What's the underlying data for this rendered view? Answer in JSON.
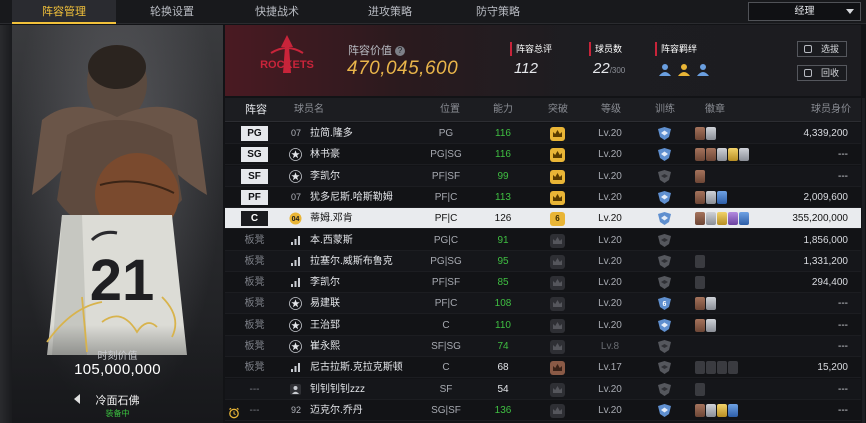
{
  "tabs": [
    {
      "label": "阵容管理",
      "active": true
    },
    {
      "label": "轮换设置",
      "active": false
    },
    {
      "label": "快捷战术",
      "active": false
    },
    {
      "label": "进攻策略",
      "active": false
    },
    {
      "label": "防守策略",
      "active": false
    }
  ],
  "role_select": {
    "value": "经理"
  },
  "card": {
    "jersey_number": "21",
    "value_label": "时刻价值",
    "value": "105,000,000",
    "name": "冷面石佛",
    "status": "装备中"
  },
  "header": {
    "team_logo_text": "ROCKETS",
    "lineup_value_label": "阵容价值",
    "lineup_value": "470,045,600",
    "rating_label": "阵容总评",
    "rating": "112",
    "count_label": "球员数",
    "count": "22",
    "count_max": "/300",
    "bond_label": "阵容羁绊",
    "btn_select": "选拔",
    "btn_recycle": "回收"
  },
  "table": {
    "headers": {
      "lineup": "阵容",
      "name": "球员名",
      "position": "位置",
      "ability": "能力",
      "breakthrough": "突破",
      "level": "等级",
      "training": "训练",
      "badges": "徽章",
      "value": "球员身价"
    },
    "rows": [
      {
        "slot": "PG",
        "starter": true,
        "num": "07",
        "icon": "",
        "name": "拉简.隆多",
        "pos": "PG",
        "ability": "116",
        "ability_color": "green",
        "bt": "on",
        "bt_num": "",
        "level": "Lv.20",
        "shield": "blue",
        "badges": [
          "copper",
          "silver"
        ],
        "value": "4,339,200"
      },
      {
        "slot": "SG",
        "starter": true,
        "num": "",
        "icon": "star",
        "name": "林书豪",
        "pos": "PG|SG",
        "ability": "116",
        "ability_color": "green",
        "bt": "on",
        "bt_num": "",
        "level": "Lv.20",
        "shield": "blue",
        "badges": [
          "copper",
          "copper",
          "silver",
          "gold",
          "silver"
        ],
        "value": "---"
      },
      {
        "slot": "SF",
        "starter": true,
        "num": "",
        "icon": "star",
        "name": "李凯尔",
        "pos": "PF|SF",
        "ability": "99",
        "ability_color": "green",
        "bt": "on",
        "bt_num": "",
        "level": "Lv.20",
        "shield": "grey",
        "badges": [
          "copper"
        ],
        "value": "---"
      },
      {
        "slot": "PF",
        "starter": true,
        "num": "07",
        "icon": "",
        "name": "犹多尼斯.哈斯勒姆",
        "pos": "PF|C",
        "ability": "113",
        "ability_color": "green",
        "bt": "on",
        "bt_num": "",
        "level": "Lv.20",
        "shield": "blue",
        "badges": [
          "copper",
          "silver",
          "blue"
        ],
        "value": "2,009,600"
      },
      {
        "slot": "C",
        "starter": true,
        "num": "",
        "icon": "gold04",
        "name": "蒂姆.邓肯",
        "pos": "PF|C",
        "ability": "126",
        "ability_color": "white",
        "bt": "on",
        "bt_num": "6",
        "level": "Lv.20",
        "shield": "blue",
        "badges": [
          "copper",
          "silver",
          "gold",
          "purple",
          "blue"
        ],
        "value": "355,200,000",
        "selected": true
      },
      {
        "slot": "板凳",
        "starter": false,
        "num": "",
        "icon": "bars",
        "name": "本.西蒙斯",
        "pos": "PG|C",
        "ability": "91",
        "ability_color": "green",
        "bt": "off",
        "bt_num": "",
        "level": "Lv.20",
        "shield": "grey",
        "badges": [],
        "value": "1,856,000"
      },
      {
        "slot": "板凳",
        "starter": false,
        "num": "",
        "icon": "bars",
        "name": "拉塞尔.威斯布鲁克",
        "pos": "PG|SG",
        "ability": "95",
        "ability_color": "green",
        "bt": "off",
        "bt_num": "",
        "level": "Lv.20",
        "shield": "grey",
        "badges": [
          "dimslot"
        ],
        "value": "1,331,200"
      },
      {
        "slot": "板凳",
        "starter": false,
        "num": "",
        "icon": "bars",
        "name": "李凯尔",
        "pos": "PF|SF",
        "ability": "85",
        "ability_color": "green",
        "bt": "off",
        "bt_num": "",
        "level": "Lv.20",
        "shield": "grey",
        "badges": [
          "dimslot"
        ],
        "value": "294,400"
      },
      {
        "slot": "板凳",
        "starter": false,
        "num": "",
        "icon": "star",
        "name": "易建联",
        "pos": "PF|C",
        "ability": "108",
        "ability_color": "green",
        "bt": "off",
        "bt_num": "",
        "level": "Lv.20",
        "shield": "blue6",
        "badges": [
          "copper",
          "silver"
        ],
        "value": "---"
      },
      {
        "slot": "板凳",
        "starter": false,
        "num": "",
        "icon": "star",
        "name": "王治郅",
        "pos": "C",
        "ability": "110",
        "ability_color": "green",
        "bt": "off",
        "bt_num": "",
        "level": "Lv.20",
        "shield": "blue",
        "badges": [
          "copper",
          "silver"
        ],
        "value": "---"
      },
      {
        "slot": "板凳",
        "starter": false,
        "num": "",
        "icon": "star",
        "name": "崔永熙",
        "pos": "SF|SG",
        "ability": "74",
        "ability_color": "green",
        "bt": "off",
        "bt_num": "",
        "level": "Lv.8",
        "level_dim": true,
        "shield": "grey",
        "badges": [],
        "value": "---"
      },
      {
        "slot": "板凳",
        "starter": false,
        "num": "",
        "icon": "bars",
        "name": "尼古拉斯.克拉克斯顿",
        "pos": "C",
        "ability": "68",
        "ability_color": "white",
        "bt": "brown",
        "bt_num": "",
        "level": "Lv.17",
        "shield": "grey",
        "badges": [
          "dimslot",
          "dimslot",
          "dimslot",
          "dimslot"
        ],
        "value": "15,200"
      },
      {
        "slot": "---",
        "starter": false,
        "num": "",
        "icon": "person",
        "name": "钊钊钊钊zzz",
        "pos": "SF",
        "ability": "54",
        "ability_color": "white",
        "bt": "off",
        "bt_num": "",
        "level": "Lv.20",
        "shield": "grey",
        "badges": [
          "dimslot"
        ],
        "value": "---"
      },
      {
        "slot": "---",
        "starter": false,
        "num": "92",
        "icon": "",
        "name": "迈克尔.乔丹",
        "pos": "SG|SF",
        "ability": "136",
        "ability_color": "green",
        "bt": "off",
        "bt_num": "",
        "level": "Lv.20",
        "shield": "blue",
        "badges": [
          "copper",
          "silver",
          "gold",
          "blue"
        ],
        "value": "---"
      }
    ]
  },
  "colors": {
    "accent": "#f2c13a",
    "green": "#3fbf42",
    "red": "#c8243a",
    "gold_text": "#e9b54a"
  }
}
